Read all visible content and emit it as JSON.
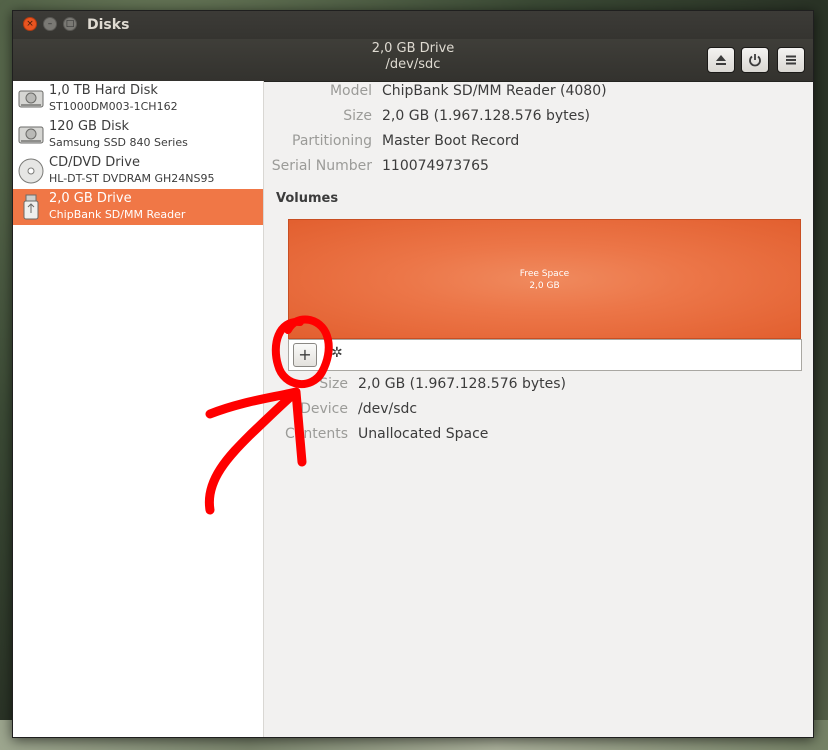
{
  "window": {
    "title": "Disks"
  },
  "header": {
    "drive_name": "2,0 GB Drive",
    "device_path": "/dev/sdc",
    "icons": [
      "eject-icon",
      "power-icon",
      "hamburger-menu-icon"
    ]
  },
  "sidebar": {
    "items": [
      {
        "title": "1,0 TB Hard Disk",
        "subtitle": "ST1000DM003-1CH162",
        "icon": "hard-disk-icon",
        "selected": false
      },
      {
        "title": "120 GB Disk",
        "subtitle": "Samsung SSD 840 Series",
        "icon": "hard-disk-icon",
        "selected": false
      },
      {
        "title": "CD/DVD Drive",
        "subtitle": "HL-DT-ST DVDRAM GH24NS95",
        "icon": "optical-disc-icon",
        "selected": false
      },
      {
        "title": "2,0 GB Drive",
        "subtitle": "ChipBank SD/MM Reader",
        "icon": "usb-drive-icon",
        "selected": true
      }
    ]
  },
  "details": {
    "model_label": "Model",
    "model_value": "ChipBank SD/MM Reader (4080)",
    "size_label": "Size",
    "size_value": "2,0 GB (1.967.128.576 bytes)",
    "partitioning_label": "Partitioning",
    "partitioning_value": "Master Boot Record",
    "serial_label": "Serial Number",
    "serial_value": "110074973765"
  },
  "volumes": {
    "heading": "Volumes",
    "partition_name": "Free Space",
    "partition_size": "2,0 GB",
    "add_button": "+",
    "gear_glyph": "✲"
  },
  "volume_details": {
    "size_label": "Size",
    "size_value": "2,0 GB (1.967.128.576 bytes)",
    "device_label": "Device",
    "device_value": "/dev/sdc",
    "contents_label": "Contents",
    "contents_value": "Unallocated Space"
  },
  "colors": {
    "accent": "#f07746",
    "annotation": "#ff0000",
    "headerbar": "#3c3b37"
  }
}
